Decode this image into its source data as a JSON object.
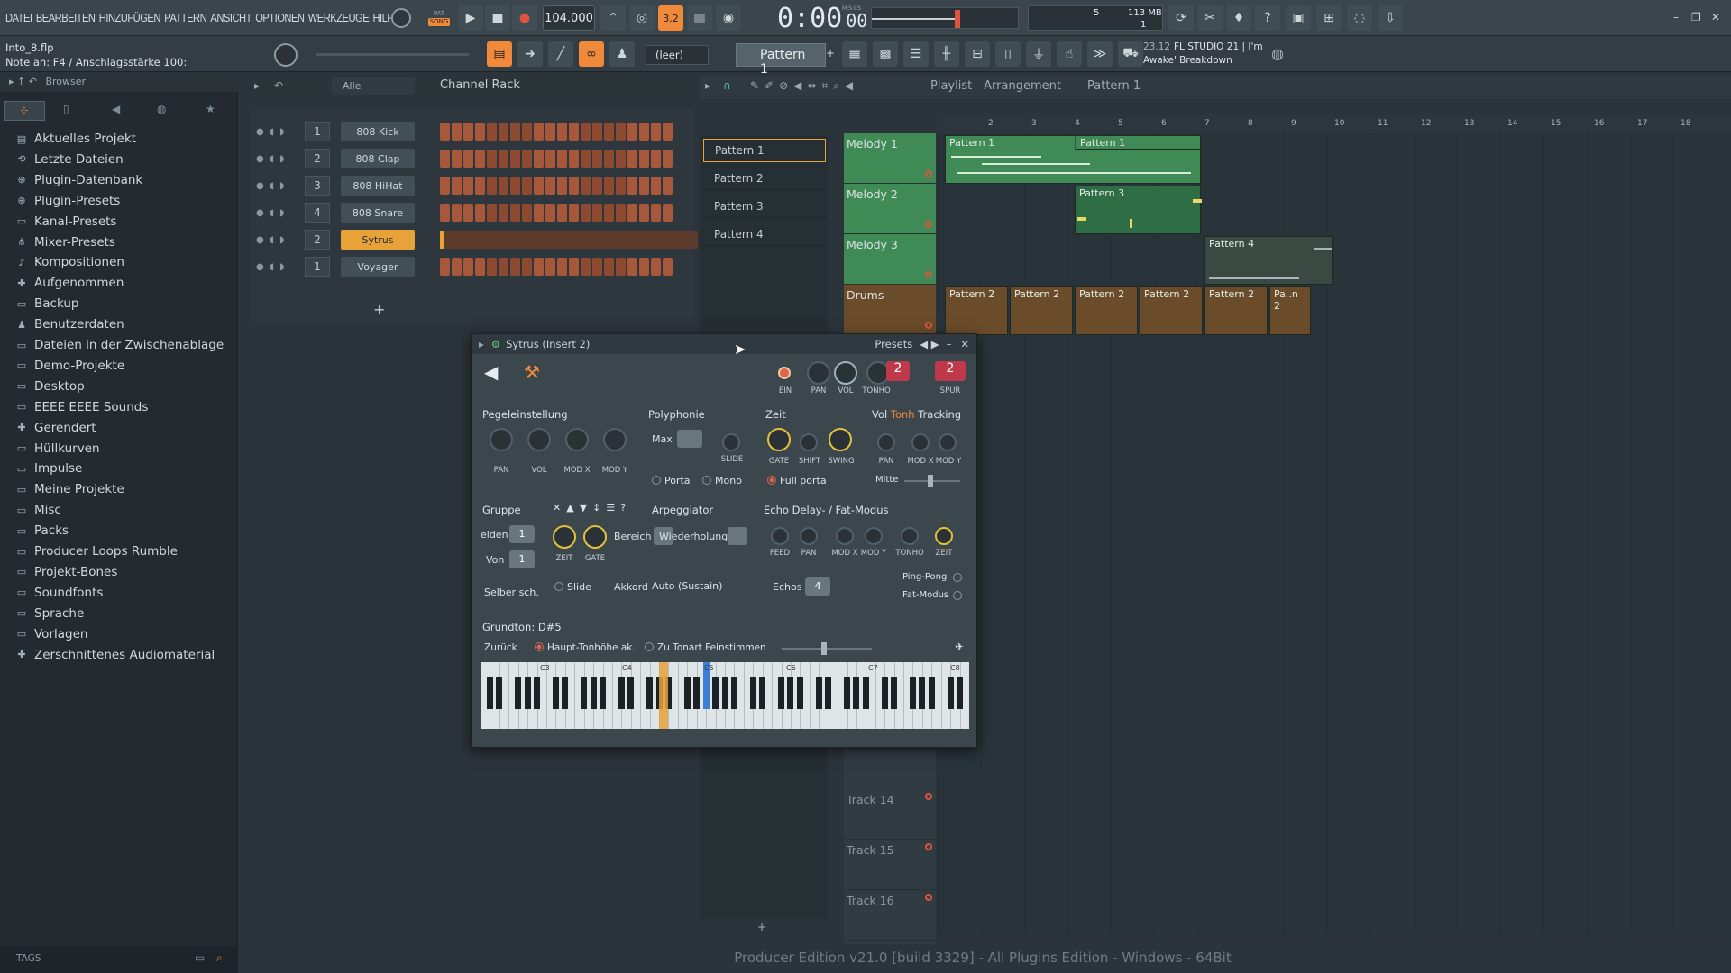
{
  "menu": [
    "DATEI",
    "BEARBEITEN",
    "HINZUFÜGEN",
    "PATTERN",
    "ANSICHT",
    "OPTIONEN",
    "WERKZEUGE",
    "HILFE"
  ],
  "transport": {
    "mode_top": "PAT",
    "mode_bottom": "SONG",
    "tempo": "104.000",
    "time_main": "0:00",
    "time_sub": "00",
    "time_label": "M:S:CS",
    "pattern_num": "3.2",
    "cpu_num": "5",
    "memory": "113 MB",
    "poly": "1"
  },
  "file": {
    "name": "Into_8.flp",
    "hint": "Note an: F4 / Anschlagsstärke 100:"
  },
  "second": {
    "snap": "(leer)",
    "pattern": "Pattern 1",
    "news_time": "23.12",
    "news_line1": "FL STUDIO 21 | I'm",
    "news_line2": "Awake' Breakdown"
  },
  "browser": {
    "title": "Browser",
    "items": [
      "Aktuelles Projekt",
      "Letzte Dateien",
      "Plugin-Datenbank",
      "Plugin-Presets",
      "Kanal-Presets",
      "Mixer-Presets",
      "Kompositionen",
      "Aufgenommen",
      "Backup",
      "Benutzerdaten",
      "Dateien in der Zwischenablage",
      "Demo-Projekte",
      "Desktop",
      "EEEE EEEE Sounds",
      "Gerendert",
      "Hüllkurven",
      "Impulse",
      "Meine Projekte",
      "Misc",
      "Packs",
      "Producer Loops Rumble",
      "Projekt-Bones",
      "Soundfonts",
      "Sprache",
      "Vorlagen",
      "Zerschnittenes Audiomaterial"
    ],
    "tags": "TAGS"
  },
  "rack": {
    "filter": "Alle",
    "title": "Channel Rack",
    "add": "+",
    "channels": [
      {
        "num": "1",
        "name": "808 Kick"
      },
      {
        "num": "2",
        "name": "808 Clap"
      },
      {
        "num": "3",
        "name": "808 HiHat"
      },
      {
        "num": "4",
        "name": "808 Snare"
      },
      {
        "num": "2",
        "name": "Sytrus"
      },
      {
        "num": "1",
        "name": "Voyager"
      }
    ]
  },
  "playlist": {
    "title": "Playlist - Arrangement",
    "pattern": "Pattern 1",
    "patterns": [
      "Pattern 1",
      "Pattern 2",
      "Pattern 3",
      "Pattern 4"
    ],
    "tracks": [
      "Melody 1",
      "Melody 2",
      "Melody 3",
      "Drums"
    ],
    "empty_tracks": [
      "Track 14",
      "Track 15",
      "Track 16"
    ],
    "ruler": [
      "2",
      "3",
      "4",
      "5",
      "6",
      "7",
      "8",
      "9",
      "10",
      "11",
      "12",
      "13",
      "14",
      "15",
      "16",
      "17",
      "18"
    ],
    "clips": {
      "p1a": "Pattern 1",
      "p1b": "Pattern 1",
      "p3": "Pattern 3",
      "p4": "Pattern 4",
      "d1": "Pattern 2",
      "d2": "Pattern 2",
      "d3": "Pattern 2",
      "d4": "Pattern 2",
      "d5": "Pattern 2",
      "d6": "Pa..n 2"
    },
    "add": "+"
  },
  "sytrus": {
    "title": "Sytrus (Insert 2)",
    "presets": "Presets",
    "knob_labels": {
      "ein": "EIN",
      "pan": "PAN",
      "vol": "VOL",
      "tonho": "TONHO",
      "spur": "SPUR"
    },
    "spur_val": "2",
    "pitch_val": "2",
    "pegel": "Pegeleinstellung",
    "pegel_knobs": [
      "PAN",
      "VOL",
      "MOD X",
      "MOD Y"
    ],
    "poly": "Polyphonie",
    "max": "Max",
    "slide": "SLIDE",
    "porta": "Porta",
    "mono": "Mono",
    "zeit": "Zeit",
    "zeit_knobs": [
      "GATE",
      "SHIFT",
      "SWING"
    ],
    "full_porta": "Full porta",
    "tracking_vol": "Vol",
    "tracking_tonh": "Tonh",
    "tracking": "Tracking",
    "track_knobs": [
      "PAN",
      "MOD X",
      "MOD Y"
    ],
    "mitte": "Mitte",
    "gruppe": "Gruppe",
    "arp": "Arpeggiator",
    "zeit_k": "ZEIT",
    "gate_k": "GATE",
    "bereich": "Bereich",
    "wiederholung": "Wiederholung",
    "eiden": "eiden",
    "von": "Von",
    "val1": "1",
    "val2": "1",
    "selber": "Selber sch.",
    "slide2": "Slide",
    "akkord": "Akkord",
    "akkord_val": "Auto (Sustain)",
    "echo": "Echo Delay- / Fat-Modus",
    "echo_knobs": [
      "FEED",
      "PAN",
      "MOD X",
      "MOD Y",
      "TONHO",
      "ZEIT"
    ],
    "echos": "Echos",
    "echos_val": "4",
    "pingpong": "Ping-Pong",
    "fat": "Fat-Modus",
    "grundton": "Grundton: D#5",
    "zurueck": "Zurück",
    "haupt": "Haupt-Tonhöhe ak.",
    "tonart": "Zu Tonart Feinstimmen",
    "octaves": [
      "C3",
      "C4",
      "C5",
      "C6",
      "C7",
      "C8"
    ]
  },
  "status": "Producer Edition v21.0 [build 3329] - All Plugins Edition - Windows - 64Bit",
  "colors": {
    "accent": "#f08a3a",
    "green_clip": "#3f8a55",
    "drums_clip": "#6a4b2a",
    "highlight": "#e8a23a"
  }
}
